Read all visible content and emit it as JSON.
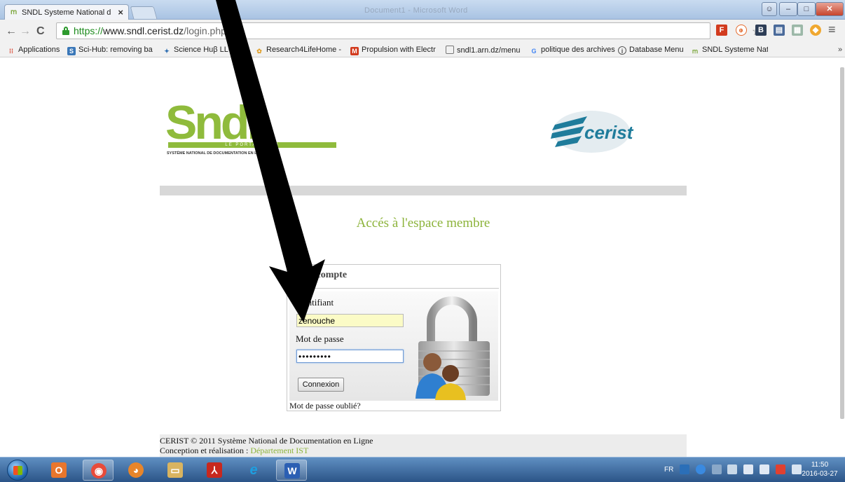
{
  "browser": {
    "tab_title": "SNDL Systeme National d",
    "tab_close": "×",
    "background_window_title": "Document1 - Microsoft Word",
    "url": {
      "scheme": "https://",
      "host": "www.sndl.cerist.dz",
      "path": "/login.php"
    },
    "bookmarks": [
      {
        "label": "Applications",
        "icon": "apps-grid-icon",
        "color": "#d8402a"
      },
      {
        "label": "Sci-Hub: removing ba",
        "icon": "scihub-icon",
        "color": "#3a77b8"
      },
      {
        "label": "Science Huβ LLC, L",
        "icon": "sciencehub-icon",
        "color": "#2f6fb2"
      },
      {
        "label": "Research4LifeHome -",
        "icon": "research4life-icon",
        "color": "#e0a02a"
      },
      {
        "label": "Propulsion with Electr",
        "icon": "gmail-icon",
        "color": "#d23b1e"
      },
      {
        "label": "sndl1.arn.dz/menu",
        "icon": "page-icon",
        "color": "#ffffff"
      },
      {
        "label": "politique des archives",
        "icon": "google-icon",
        "color": "#4285f4"
      },
      {
        "label": "Database Menu",
        "icon": "database-icon",
        "color": "#555555"
      },
      {
        "label": "SNDL Systeme Nation",
        "icon": "sndl-icon",
        "color": "#7aa63a"
      }
    ],
    "bookmarks_more": "»"
  },
  "page": {
    "logo_sndl_word": "Sndl",
    "logo_sndl_banner": "LE PORTAIL WEB",
    "logo_sndl_subtitle": "SYSTÈME NATIONAL DE DOCUMENTATION EN LIGNE",
    "logo_cerist_word": "cerist",
    "heading": "Accés à l'espace membre",
    "login": {
      "title": "Mon compte",
      "username_label": "Identifiant",
      "username_value": "zenouche",
      "password_label": "Mot de passe",
      "password_value": "•••••••••",
      "submit_label": "Connexion",
      "forgot_label": "Mot de passe oublié?"
    },
    "footer": {
      "line1": "CERIST © 2011 Système National de Documentation en Ligne",
      "line2_prefix": "Conception et réalisation : ",
      "line2_link": "Département IST"
    }
  },
  "taskbar": {
    "language": "FR",
    "clock_time": "11:50",
    "clock_date": "2016-03-27"
  },
  "colors": {
    "sndl_green": "#8cb33a",
    "cerist_blue": "#1f7c9b",
    "arrow": "#000000"
  }
}
